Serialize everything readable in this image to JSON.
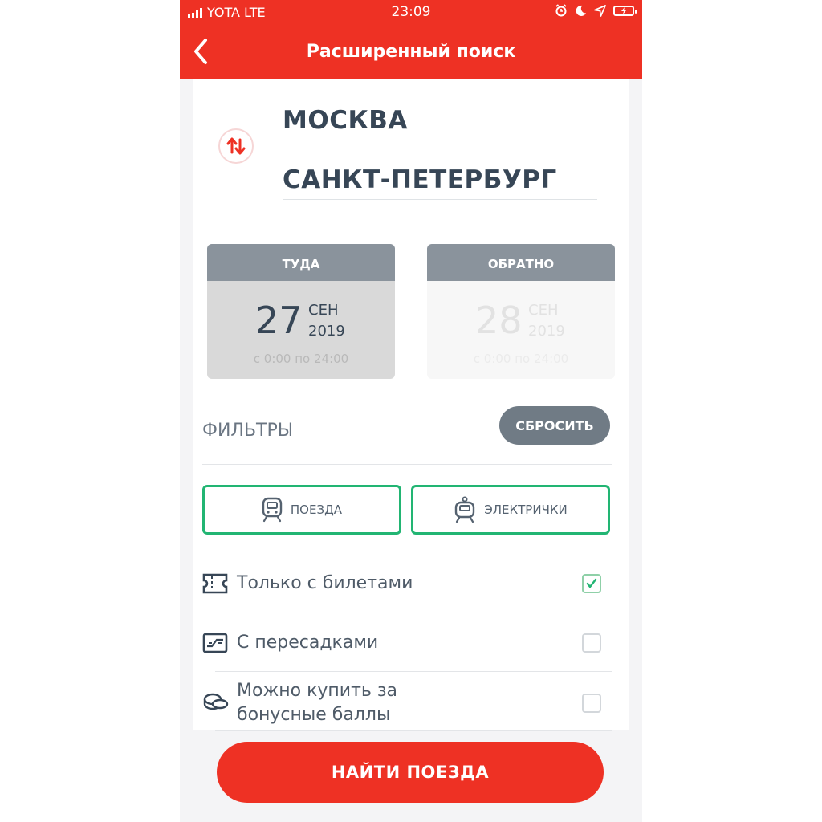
{
  "status_bar": {
    "carrier": "YOTA LTE",
    "time": "23:09"
  },
  "header": {
    "title": "Расширенный поиск"
  },
  "route": {
    "from": "МОСКВА",
    "to": "САНКТ-ПЕТЕРБУРГ"
  },
  "dates": {
    "there": {
      "label": "ТУДА",
      "day": "27",
      "month": "СЕН",
      "year": "2019",
      "time": "с 0:00 по 24:00"
    },
    "back": {
      "label": "ОБРАТНО",
      "day": "28",
      "month": "СЕН",
      "year": "2019",
      "time": "с 0:00 по 24:00"
    }
  },
  "filters": {
    "title": "ФИЛЬТРЫ",
    "reset_label": "СБРОСИТЬ",
    "types": [
      {
        "label": "ПОЕЗДА",
        "icon": "train-icon"
      },
      {
        "label": "ЭЛЕКТРИЧКИ",
        "icon": "suburban-train-icon"
      }
    ],
    "options": [
      {
        "label": "Только с билетами",
        "icon": "ticket-icon",
        "checked": true
      },
      {
        "label": "С пересадками",
        "icon": "transfer-icon",
        "checked": false
      },
      {
        "label_line1": "Можно купить за",
        "label_line2": "бонусные баллы",
        "icon": "coins-icon",
        "checked": false
      }
    ]
  },
  "search_button": {
    "label": "НАЙТИ ПОЕЗДА"
  },
  "colors": {
    "brand_red": "#ee3124",
    "accent_green": "#22b573",
    "text_dark": "#374656",
    "gray_button": "#707b85"
  }
}
